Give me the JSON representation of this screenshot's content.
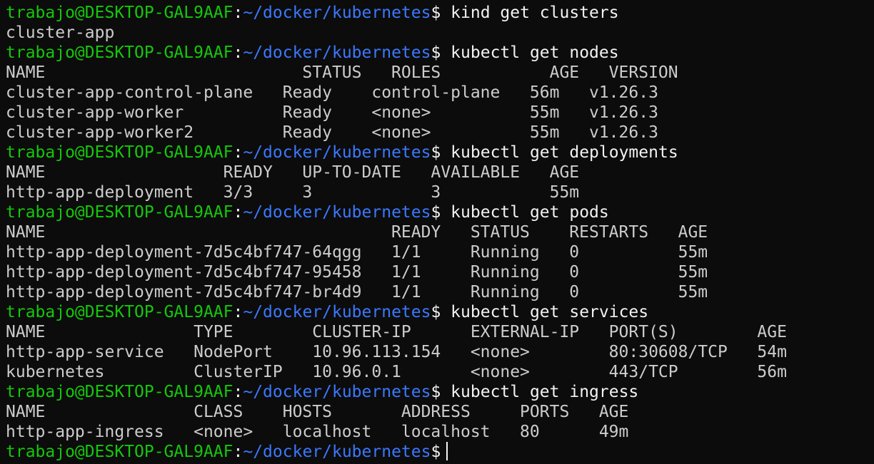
{
  "prompt": {
    "user_host": "trabajo@DESKTOP-GAL9AAF",
    "sep": ":",
    "path": "~/docker/kubernetes",
    "symbol": "$"
  },
  "colors": {
    "background": "#0c0c0c",
    "prompt_user": "#16c60c",
    "prompt_path": "#3b78ff",
    "text": "#cccccc"
  },
  "blocks": [
    {
      "command": " kind get clusters",
      "output": [
        "cluster-app"
      ]
    },
    {
      "command": " kubectl get nodes",
      "output": [
        "NAME                          STATUS   ROLES           AGE   VERSION",
        "cluster-app-control-plane   Ready    control-plane   56m   v1.26.3",
        "cluster-app-worker          Ready    <none>          55m   v1.26.3",
        "cluster-app-worker2         Ready    <none>          55m   v1.26.3"
      ]
    },
    {
      "command": " kubectl get deployments",
      "output": [
        "NAME                  READY   UP-TO-DATE   AVAILABLE   AGE",
        "http-app-deployment   3/3     3            3           55m"
      ]
    },
    {
      "command": " kubectl get pods",
      "output": [
        "NAME                                   READY   STATUS    RESTARTS   AGE",
        "http-app-deployment-7d5c4bf747-64qgg   1/1     Running   0          55m",
        "http-app-deployment-7d5c4bf747-95458   1/1     Running   0          55m",
        "http-app-deployment-7d5c4bf747-br4d9   1/1     Running   0          55m"
      ]
    },
    {
      "command": " kubectl get services",
      "output": [
        "NAME               TYPE        CLUSTER-IP      EXTERNAL-IP   PORT(S)        AGE",
        "http-app-service   NodePort    10.96.113.154   <none>        80:30608/TCP   54m",
        "kubernetes         ClusterIP   10.96.0.1       <none>        443/TCP        56m"
      ]
    },
    {
      "command": " kubectl get ingress",
      "output": [
        "NAME               CLASS    HOSTS       ADDRESS     PORTS   AGE",
        "http-app-ingress   <none>   localhost   localhost   80      49m"
      ]
    }
  ],
  "final_prompt_command": " "
}
